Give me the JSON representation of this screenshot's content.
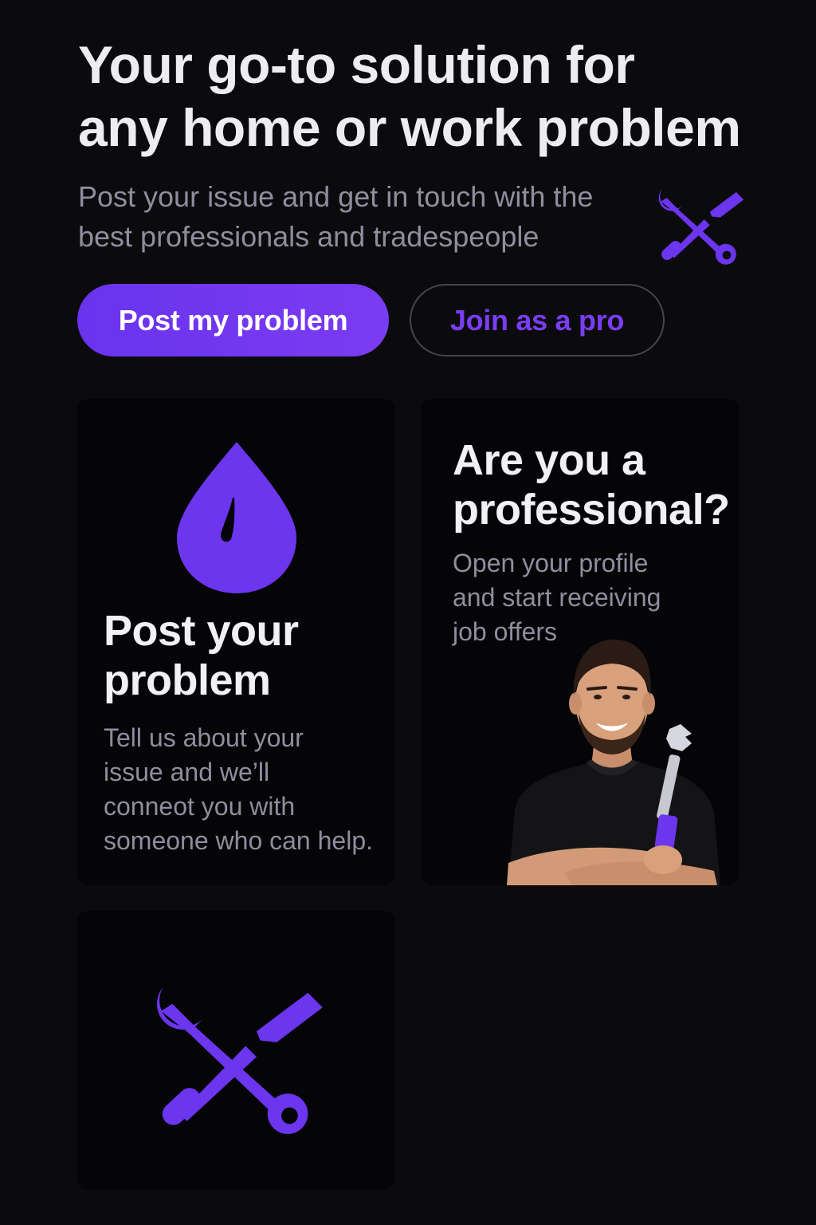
{
  "hero": {
    "title_line1": "Your go-to solution for",
    "title_line2": "any home or work problem",
    "subtitle_line1": "Post your issue and get in touch with the",
    "subtitle_line2": "best professionals and tradespeople",
    "icon": "tools-icon"
  },
  "actions": {
    "post_label": "Post my problem",
    "join_label": "Join as a pro"
  },
  "cards": {
    "post": {
      "icon": "water-drop-icon",
      "title_line1": "Post your",
      "title_line2": "problem",
      "text_line1": "Tell us about your",
      "text_line2": "issue and we’ll",
      "text_line3": "conneot you with",
      "text_line4": "someone who can help."
    },
    "pro": {
      "title_line1": "Are you a",
      "title_line2": "professional?",
      "text_line1": "Open your profile",
      "text_line2": "and start receiving",
      "text_line3": "job offers",
      "image": "professional-with-wrench-photo"
    },
    "tools": {
      "icon": "tools-icon"
    }
  },
  "colors": {
    "background": "#0b0b0d",
    "card": "#050508",
    "accent": "#6c35ee",
    "title": "#ececf1",
    "muted": "#8e8e9e",
    "button_border": "#45454d"
  }
}
